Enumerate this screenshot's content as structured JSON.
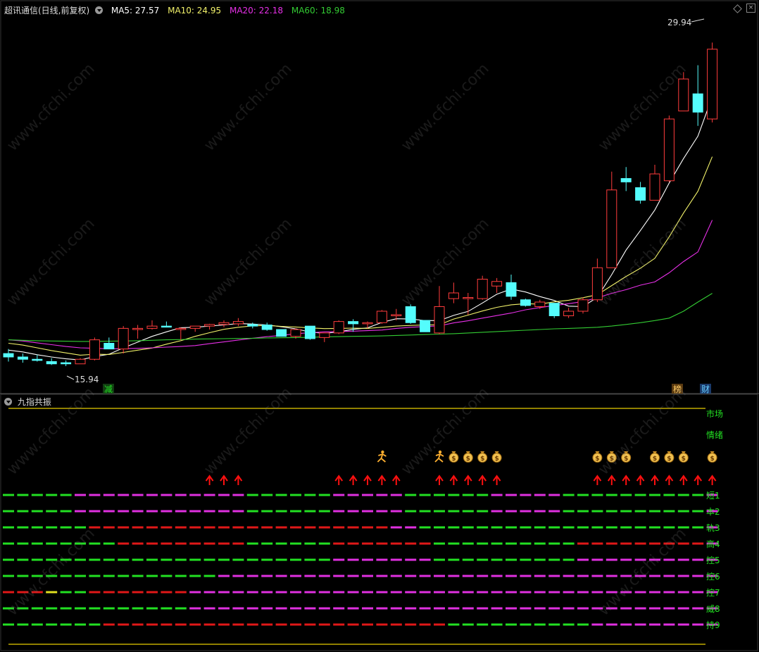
{
  "header": {
    "title": "超讯通信(日线,前复权)",
    "ma5": "MA5: 27.57",
    "ma10": "MA10: 24.95",
    "ma20": "MA20: 22.18",
    "ma60": "MA60: 18.98"
  },
  "subpanel": {
    "title": "九指共振",
    "right_labels": [
      "市场",
      "情绪",
      "短1",
      "本2",
      "轨3",
      "高4",
      "控5",
      "控6",
      "控7",
      "威8",
      "持9"
    ]
  },
  "watermark": "www.cfchi.com",
  "colors": {
    "background": "#000000",
    "up": "#ff3c3c",
    "down": "#54fcfc",
    "ma5": "#ffffff",
    "ma10": "#f2f26a",
    "ma20": "#e830e8",
    "ma60": "#33cc33",
    "bar_green": "#22e022",
    "bar_magenta": "#e030e0",
    "bar_red": "#e01818",
    "bar_yellow": "#e0e020",
    "signal_red": "#ff1010",
    "olive": "#908000"
  },
  "chart_data": [
    {
      "type": "candlestick",
      "title": "超讯通信(日线,前复权)",
      "ylim": [
        15,
        31
      ],
      "annotations": {
        "high_label": "29.94",
        "low_label": "15.94",
        "events": [
          "减",
          "榜",
          "财"
        ]
      },
      "candles": [
        {
          "o": 16.35,
          "h": 16.55,
          "l": 16.0,
          "c": 16.2
        },
        {
          "o": 16.2,
          "h": 16.35,
          "l": 15.95,
          "c": 16.1
        },
        {
          "o": 16.1,
          "h": 16.3,
          "l": 16.0,
          "c": 16.05
        },
        {
          "o": 16.0,
          "h": 16.15,
          "l": 15.85,
          "c": 15.9
        },
        {
          "o": 15.95,
          "h": 16.05,
          "l": 15.8,
          "c": 15.9
        },
        {
          "o": 15.9,
          "h": 16.15,
          "l": 15.94,
          "c": 16.1
        },
        {
          "o": 16.1,
          "h": 17.05,
          "l": 16.05,
          "c": 16.95
        },
        {
          "o": 16.8,
          "h": 17.05,
          "l": 16.55,
          "c": 16.55
        },
        {
          "o": 16.55,
          "h": 17.55,
          "l": 16.35,
          "c": 17.45
        },
        {
          "o": 17.4,
          "h": 17.6,
          "l": 17.0,
          "c": 17.45
        },
        {
          "o": 17.45,
          "h": 17.8,
          "l": 17.4,
          "c": 17.55
        },
        {
          "o": 17.55,
          "h": 17.75,
          "l": 17.5,
          "c": 17.52
        },
        {
          "o": 17.4,
          "h": 17.5,
          "l": 16.95,
          "c": 17.45
        },
        {
          "o": 17.45,
          "h": 17.55,
          "l": 17.3,
          "c": 17.55
        },
        {
          "o": 17.55,
          "h": 17.65,
          "l": 17.4,
          "c": 17.62
        },
        {
          "o": 17.62,
          "h": 17.8,
          "l": 17.5,
          "c": 17.7
        },
        {
          "o": 17.65,
          "h": 17.9,
          "l": 17.55,
          "c": 17.75
        },
        {
          "o": 17.62,
          "h": 17.7,
          "l": 17.45,
          "c": 17.55
        },
        {
          "o": 17.6,
          "h": 17.7,
          "l": 17.35,
          "c": 17.4
        },
        {
          "o": 17.4,
          "h": 17.4,
          "l": 17.1,
          "c": 17.1
        },
        {
          "o": 17.1,
          "h": 17.45,
          "l": 17.0,
          "c": 17.4
        },
        {
          "o": 17.55,
          "h": 17.55,
          "l": 16.95,
          "c": 17.0
        },
        {
          "o": 17.05,
          "h": 17.25,
          "l": 16.85,
          "c": 17.25
        },
        {
          "o": 17.25,
          "h": 17.8,
          "l": 17.2,
          "c": 17.75
        },
        {
          "o": 17.75,
          "h": 17.85,
          "l": 17.3,
          "c": 17.65
        },
        {
          "o": 17.65,
          "h": 17.75,
          "l": 17.45,
          "c": 17.7
        },
        {
          "o": 17.7,
          "h": 18.25,
          "l": 17.65,
          "c": 18.2
        },
        {
          "o": 18.0,
          "h": 18.3,
          "l": 17.8,
          "c": 18.05
        },
        {
          "o": 18.4,
          "h": 18.5,
          "l": 17.65,
          "c": 17.7
        },
        {
          "o": 17.8,
          "h": 17.8,
          "l": 17.3,
          "c": 17.3
        },
        {
          "o": 17.25,
          "h": 19.3,
          "l": 17.2,
          "c": 18.4
        },
        {
          "o": 18.75,
          "h": 19.45,
          "l": 18.55,
          "c": 19.0
        },
        {
          "o": 18.75,
          "h": 19.0,
          "l": 18.05,
          "c": 18.8
        },
        {
          "o": 18.75,
          "h": 19.75,
          "l": 18.7,
          "c": 19.6
        },
        {
          "o": 19.3,
          "h": 19.65,
          "l": 19.0,
          "c": 19.5
        },
        {
          "o": 19.45,
          "h": 19.8,
          "l": 18.7,
          "c": 18.85
        },
        {
          "o": 18.7,
          "h": 18.75,
          "l": 18.4,
          "c": 18.45
        },
        {
          "o": 18.4,
          "h": 18.7,
          "l": 18.3,
          "c": 18.6
        },
        {
          "o": 18.55,
          "h": 18.55,
          "l": 17.9,
          "c": 18.0
        },
        {
          "o": 18.0,
          "h": 18.35,
          "l": 17.9,
          "c": 18.2
        },
        {
          "o": 18.2,
          "h": 18.8,
          "l": 18.1,
          "c": 18.7
        },
        {
          "o": 18.7,
          "h": 20.5,
          "l": 18.6,
          "c": 20.1
        },
        {
          "o": 20.1,
          "h": 24.3,
          "l": 20.1,
          "c": 23.5
        },
        {
          "o": 24.0,
          "h": 24.5,
          "l": 23.45,
          "c": 23.85
        },
        {
          "o": 23.6,
          "h": 23.85,
          "l": 22.9,
          "c": 23.05
        },
        {
          "o": 23.05,
          "h": 24.6,
          "l": 23.05,
          "c": 24.2
        },
        {
          "o": 23.9,
          "h": 26.75,
          "l": 23.85,
          "c": 26.6
        },
        {
          "o": 26.95,
          "h": 28.65,
          "l": 26.95,
          "c": 28.35
        },
        {
          "o": 27.7,
          "h": 28.95,
          "l": 26.3,
          "c": 26.9
        },
        {
          "o": 26.6,
          "h": 29.94,
          "l": 26.45,
          "c": 29.65
        }
      ],
      "series": [
        {
          "name": "MA5",
          "values": [
            16.5,
            16.42,
            16.3,
            16.2,
            16.12,
            16.07,
            16.22,
            16.32,
            16.6,
            16.85,
            17.1,
            17.3,
            17.48,
            17.5,
            17.55,
            17.6,
            17.66,
            17.64,
            17.6,
            17.52,
            17.43,
            17.29,
            17.23,
            17.3,
            17.41,
            17.47,
            17.71,
            17.87,
            17.86,
            17.79,
            17.79,
            18.02,
            18.19,
            18.56,
            18.94,
            19.17,
            19.04,
            18.84,
            18.67,
            18.42,
            18.4,
            18.81,
            19.8,
            20.87,
            21.73,
            22.62,
            23.8,
            24.87,
            25.85,
            27.57
          ]
        },
        {
          "name": "MA10",
          "values": [
            16.8,
            16.72,
            16.6,
            16.48,
            16.38,
            16.28,
            16.32,
            16.31,
            16.4,
            16.5,
            16.59,
            16.76,
            16.91,
            17.1,
            17.26,
            17.41,
            17.5,
            17.56,
            17.58,
            17.54,
            17.51,
            17.47,
            17.44,
            17.45,
            17.46,
            17.45,
            17.5,
            17.55,
            17.58,
            17.6,
            17.61,
            17.86,
            18.03,
            18.21,
            18.37,
            18.48,
            18.53,
            18.51,
            18.61,
            18.68,
            18.79,
            18.92,
            19.32,
            19.72,
            20.08,
            20.51,
            21.45,
            22.49,
            23.44,
            24.95
          ]
        },
        {
          "name": "MA20",
          "values": [
            16.95,
            16.9,
            16.82,
            16.74,
            16.66,
            16.6,
            16.58,
            16.56,
            16.56,
            16.58,
            16.6,
            16.63,
            16.66,
            16.7,
            16.78,
            16.86,
            16.94,
            17.02,
            17.09,
            17.14,
            17.22,
            17.26,
            17.3,
            17.31,
            17.33,
            17.35,
            17.38,
            17.45,
            17.5,
            17.53,
            17.56,
            17.69,
            17.78,
            17.9,
            18.01,
            18.12,
            18.26,
            18.36,
            18.45,
            18.53,
            18.62,
            18.79,
            18.98,
            19.14,
            19.34,
            19.48,
            19.88,
            20.37,
            20.79,
            22.18
          ]
        },
        {
          "name": "MA60",
          "values": [
            16.95,
            16.93,
            16.91,
            16.9,
            16.89,
            16.88,
            16.88,
            16.89,
            16.9,
            16.91,
            16.93,
            16.95,
            16.96,
            16.98,
            16.99,
            17.0,
            17.01,
            17.02,
            17.03,
            17.04,
            17.05,
            17.06,
            17.08,
            17.09,
            17.1,
            17.11,
            17.12,
            17.14,
            17.16,
            17.18,
            17.2,
            17.22,
            17.25,
            17.28,
            17.31,
            17.34,
            17.37,
            17.4,
            17.43,
            17.45,
            17.47,
            17.5,
            17.55,
            17.62,
            17.7,
            17.79,
            17.9,
            18.2,
            18.6,
            18.98
          ]
        }
      ]
    },
    {
      "type": "heatmap",
      "title": "九指共振",
      "rows": [
        "短1",
        "本2",
        "轨3",
        "高4",
        "控5",
        "控6",
        "控7",
        "威8",
        "持9"
      ],
      "state_colors": {
        "G": "#22e022",
        "M": "#e030e0",
        "R": "#e01818",
        "Y": "#e0e020"
      },
      "states": [
        "GGGGGMMMMMMMMMMMMGGGGGGMMMMMGGGGGGMMMMMGGGGGGGGGGM",
        "GGGGGMMMMMMMMMMMMGGGGGGMMMMMGGGGGGMMMMMGGGGGGGGGGM",
        "GGGGGGRRRRRRRRRRRRRRRRRRRRRMMGGGGGGGGGGGGGGGGGGGGM",
        "GGGGGGGGRRRRRRRRRGGGGGGRRRRRRRGGGGGGGGGGRRRRRRRRRM",
        "GGGGGGGGGGGGGGGGGGGGGGGMMMMMMMGGGGGGGGGGMMMMMMMMMM",
        "GGGGGGGGGGGGGGGMMMMMMMMMMMMMMMMMMMMMMMMMMMMMMMMMMM",
        "RRRYGGRRRRRRRMMMMMMMMMMMMMMMMMMMMMMMMMMMMMMMMMMMMM",
        "GGGGGGGGGGGGGMMMMMMMMMMMMMMMMMMMMMMMMMMMMMMMMMMMMM",
        "GGGGGGGRRRRRRRRRRRRRRRRRRRRRRRRGGGGGGGGGGMMMMMMMMM"
      ],
      "signals": {
        "up_arrow_indices": [
          14,
          15,
          16,
          23,
          24,
          25,
          26,
          27,
          30,
          31,
          32,
          33,
          34,
          41,
          42,
          43,
          44,
          45,
          46,
          47,
          48,
          49
        ],
        "runner_indices": [
          26,
          30
        ],
        "money_bag_indices": [
          31,
          32,
          33,
          34,
          41,
          42,
          43,
          45,
          46,
          47,
          49
        ]
      }
    }
  ]
}
